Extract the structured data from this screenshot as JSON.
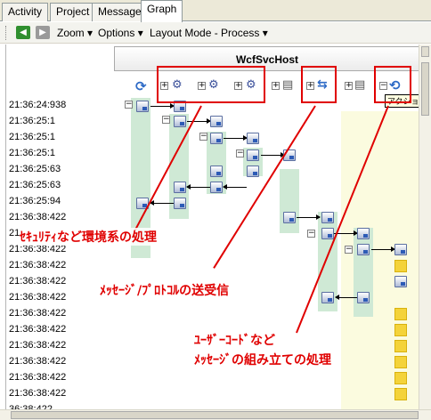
{
  "tabs": [
    "Activity",
    "Project",
    "Message",
    "Graph"
  ],
  "active_tab": "Graph",
  "toolbar": {
    "back_icon": "back-arrow-icon",
    "forward_icon": "forward-arrow-icon",
    "zoom": "Zoom",
    "zoom_key": "Z",
    "options": "Options",
    "options_key": "O",
    "layout_mode": "Layout Mode - Process",
    "layout_key": "L"
  },
  "graph": {
    "host_title": "WcfSvcHost",
    "tooltip": "アクション",
    "timestamps": [
      "21:36:24:938",
      "21:36:25:1",
      "21:36:25:1",
      "21:36:25:1",
      "21:36:25:63",
      "21:36:25:63",
      "21:36:25:94",
      "21:36:38:422",
      "21:36:38:422",
      "21:36:38:422",
      "21:36:38:422",
      "21:36:38:422",
      "21:36:38:422",
      "21:36:38:422",
      "21:36:38:422",
      "21:36:38:422",
      "21:36:38:422",
      "21:36:38:422",
      "21:36:38:422",
      "21:36:38:422"
    ],
    "timestamp_partial_first": "21:",
    "timestamp_partial_rest": "36:38:422"
  },
  "annotations": {
    "security": "ｾｷｭﾘﾃｨなど環境系の処理",
    "message": "ﾒｯｾｰｼﾞ/ﾌﾟﾛﾄｺﾙの送受信",
    "user_code_1": "ﾕｰｻﾞｰｺｰﾄﾞなど",
    "user_code_2": "ﾒｯｾｰｼﾞの組み立ての処理"
  },
  "colors": {
    "annotation_red": "#e00000",
    "lane_green": "#cfe9d5",
    "yellow_marker": "#f4d33a"
  }
}
